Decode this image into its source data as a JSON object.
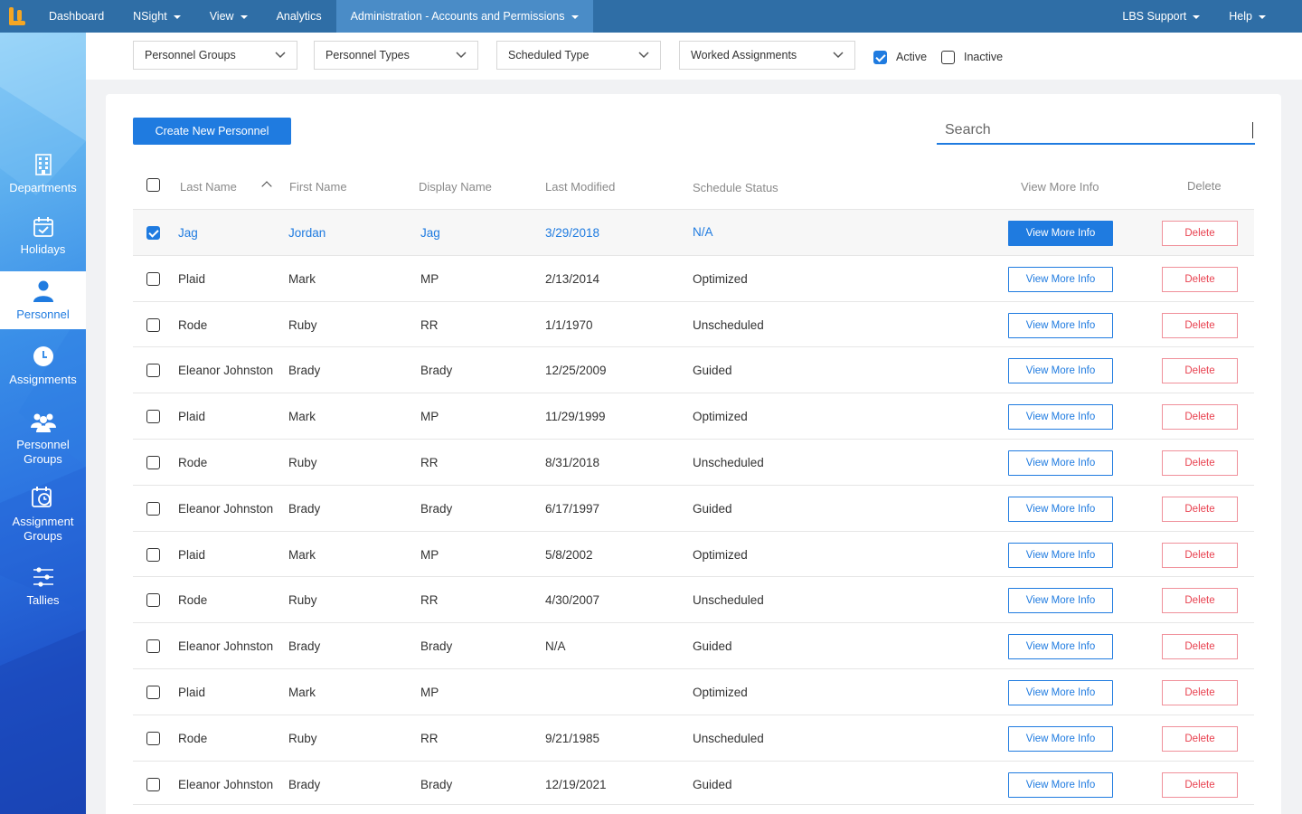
{
  "topnav": {
    "items": [
      {
        "label": "Dashboard",
        "dropdown": false
      },
      {
        "label": "NSight",
        "dropdown": true
      },
      {
        "label": "View",
        "dropdown": true
      },
      {
        "label": "Analytics",
        "dropdown": false
      },
      {
        "label": "Administration - Accounts and Permissions",
        "dropdown": true,
        "active": true
      }
    ],
    "right": [
      {
        "label": "LBS Support",
        "dropdown": true
      },
      {
        "label": "Help",
        "dropdown": true
      }
    ]
  },
  "sidebar": {
    "items": [
      {
        "label": "Departments",
        "icon": "building-icon"
      },
      {
        "label": "Holidays",
        "icon": "calendar-check-icon"
      },
      {
        "label": "Personnel",
        "icon": "person-icon",
        "active": true
      },
      {
        "label": "Assignments",
        "icon": "clock-icon"
      },
      {
        "label": "Personnel Groups",
        "icon": "group-icon"
      },
      {
        "label": "Assignment Groups",
        "icon": "calendar-clock-icon"
      },
      {
        "label": "Tallies",
        "icon": "sliders-icon"
      }
    ]
  },
  "filters": {
    "dropdowns": [
      "Personnel Groups",
      "Personnel Types",
      "Scheduled Type",
      "Worked Assignments"
    ],
    "active_label": "Active",
    "active_checked": true,
    "inactive_label": "Inactive",
    "inactive_checked": false
  },
  "actions": {
    "create_label": "Create New Personnel",
    "search_placeholder": "Search"
  },
  "table": {
    "headers": {
      "last_name": "Last Name",
      "first_name": "First Name",
      "display_name": "Display Name",
      "last_modified": "Last Modified",
      "schedule_status": "Schedule Status",
      "view_more": "View More Info",
      "delete": "Delete"
    },
    "view_label": "View More Info",
    "delete_label": "Delete",
    "rows": [
      {
        "last": "Jag",
        "first": "Jordan",
        "display": "Jag",
        "modified": "3/29/2018",
        "status": "N/A",
        "selected": true
      },
      {
        "last": "Plaid",
        "first": "Mark",
        "display": "MP",
        "modified": "2/13/2014",
        "status": "Optimized"
      },
      {
        "last": "Rode",
        "first": "Ruby",
        "display": "RR",
        "modified": "1/1/1970",
        "status": "Unscheduled"
      },
      {
        "last": "Eleanor Johnston",
        "first": "Brady",
        "display": "Brady",
        "modified": "12/25/2009",
        "status": "Guided"
      },
      {
        "last": "Plaid",
        "first": "Mark",
        "display": "MP",
        "modified": "11/29/1999",
        "status": "Optimized"
      },
      {
        "last": "Rode",
        "first": "Ruby",
        "display": "RR",
        "modified": "8/31/2018",
        "status": "Unscheduled"
      },
      {
        "last": "Eleanor Johnston",
        "first": "Brady",
        "display": "Brady",
        "modified": "6/17/1997",
        "status": "Guided"
      },
      {
        "last": "Plaid",
        "first": "Mark",
        "display": "MP",
        "modified": "5/8/2002",
        "status": "Optimized"
      },
      {
        "last": "Rode",
        "first": "Ruby",
        "display": "RR",
        "modified": "4/30/2007",
        "status": "Unscheduled"
      },
      {
        "last": "Eleanor Johnston",
        "first": "Brady",
        "display": "Brady",
        "modified": "N/A",
        "status": "Guided"
      },
      {
        "last": "Plaid",
        "first": "Mark",
        "display": "MP",
        "modified": "",
        "status": "Optimized"
      },
      {
        "last": "Rode",
        "first": "Ruby",
        "display": "RR",
        "modified": "9/21/1985",
        "status": "Unscheduled"
      },
      {
        "last": "Eleanor Johnston",
        "first": "Brady",
        "display": "Brady",
        "modified": "12/19/2021",
        "status": "Guided"
      }
    ]
  },
  "colors": {
    "nav": "#2f6ea6",
    "nav_active": "#4a8cc7",
    "accent": "#1f7be0",
    "danger": "#e8414f"
  }
}
